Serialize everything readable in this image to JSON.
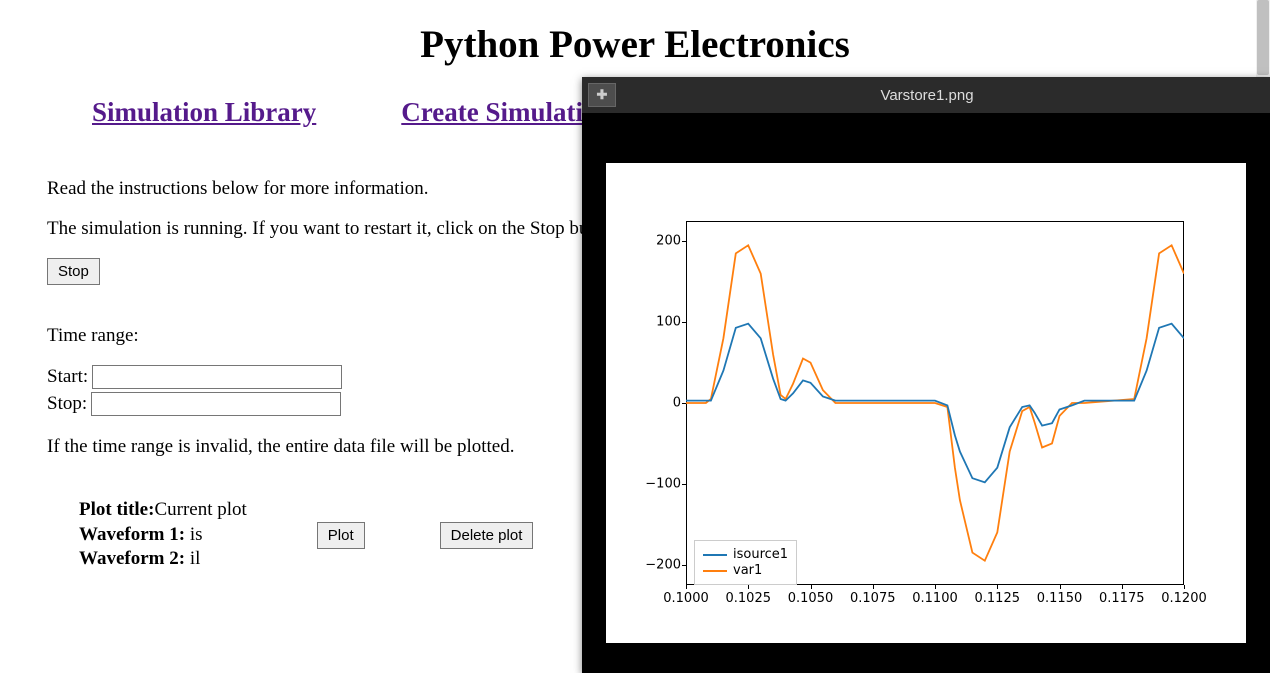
{
  "header": {
    "title": "Python Power Electronics"
  },
  "nav": {
    "simulation_library": "Simulation Library",
    "create_simulation": "Create Simulation"
  },
  "main": {
    "instructions": "Read the instructions below for more information.",
    "running_text": "The simulation is running. If you want to restart it, click on the Stop button below.",
    "stop_button": "Stop",
    "time_range_label": "Time range:",
    "start_label": "Start:",
    "stop_label": "Stop:",
    "start_value": "",
    "stop_value": "",
    "invalid_text": "If the time range is invalid, the entire data file will be plotted.",
    "plot_title_label": "Plot title:",
    "plot_title_value": "Current plot",
    "waveform1_label": "Waveform 1:",
    "waveform1_value": " is",
    "waveform2_label": "Waveform 2:",
    "waveform2_value": " il",
    "plot_button": "Plot",
    "delete_plot_button": "Delete plot"
  },
  "viewer": {
    "title": "Varstore1.png",
    "add_icon": "✚"
  },
  "chart_data": {
    "type": "line",
    "x_ticks": [
      "0.1000",
      "0.1025",
      "0.1050",
      "0.1075",
      "0.1100",
      "0.1125",
      "0.1150",
      "0.1175",
      "0.1200"
    ],
    "y_ticks": [
      "-200",
      "-100",
      "0",
      "100",
      "200"
    ],
    "xlim": [
      0.1,
      0.12
    ],
    "ylim": [
      -225,
      225
    ],
    "series": [
      {
        "name": "isource1",
        "color": "#1f77b4",
        "x": [
          0.1,
          0.1008,
          0.101,
          0.1015,
          0.102,
          0.1025,
          0.103,
          0.1035,
          0.1038,
          0.104,
          0.1043,
          0.1047,
          0.105,
          0.1055,
          0.106,
          0.109,
          0.11,
          0.1105,
          0.1108,
          0.111,
          0.1115,
          0.112,
          0.1125,
          0.113,
          0.1135,
          0.1138,
          0.114,
          0.1143,
          0.1147,
          0.115,
          0.1155,
          0.116,
          0.118,
          0.1185,
          0.119,
          0.1195,
          0.12
        ],
        "y": [
          3,
          3,
          3,
          40,
          93,
          98,
          80,
          30,
          5,
          3,
          12,
          28,
          25,
          8,
          3,
          3,
          3,
          -3,
          -40,
          -60,
          -93,
          -98,
          -80,
          -30,
          -5,
          -3,
          -12,
          -28,
          -25,
          -8,
          -3,
          3,
          3,
          40,
          93,
          98,
          80
        ]
      },
      {
        "name": "var1",
        "color": "#ff7f0e",
        "x": [
          0.1,
          0.1008,
          0.101,
          0.1015,
          0.102,
          0.1025,
          0.103,
          0.1035,
          0.1038,
          0.104,
          0.1043,
          0.1047,
          0.105,
          0.1055,
          0.106,
          0.109,
          0.11,
          0.1105,
          0.1108,
          0.111,
          0.1115,
          0.112,
          0.1125,
          0.113,
          0.1135,
          0.1138,
          0.114,
          0.1143,
          0.1147,
          0.115,
          0.1155,
          0.116,
          0.118,
          0.1185,
          0.119,
          0.1195,
          0.12
        ],
        "y": [
          0,
          0,
          5,
          80,
          185,
          195,
          160,
          60,
          10,
          5,
          24,
          55,
          50,
          16,
          0,
          0,
          0,
          -5,
          -80,
          -120,
          -185,
          -195,
          -160,
          -60,
          -10,
          -5,
          -24,
          -55,
          -50,
          -16,
          0,
          0,
          5,
          80,
          185,
          195,
          160
        ]
      }
    ]
  }
}
